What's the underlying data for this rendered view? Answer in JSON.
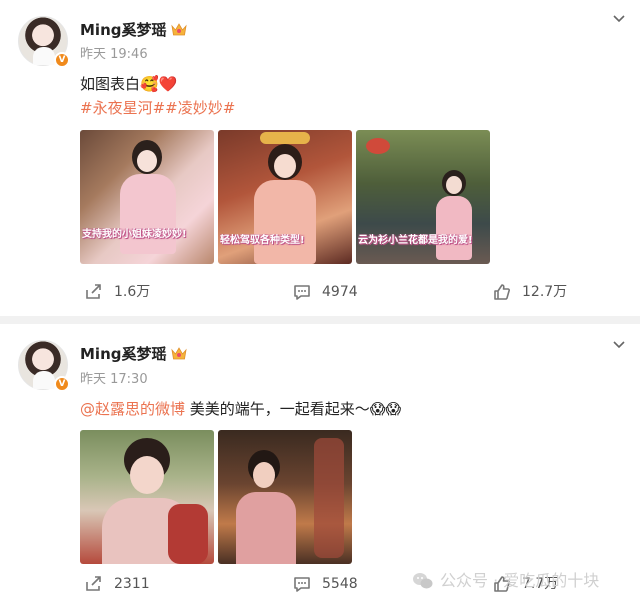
{
  "posts": [
    {
      "username": "Ming奚梦瑶",
      "verified_badge": "V",
      "time": "昨天 19:46",
      "text": "如图表白🥰❤️",
      "hashtags": "#永夜星河##凌妙妙#",
      "images": [
        {
          "caption": "支持我的小姐妹凌妙妙!"
        },
        {
          "caption": "轻松驾驭各种类型!"
        },
        {
          "caption": "云为衫小兰花都是我的爱!"
        }
      ],
      "repost_count": "1.6万",
      "comment_count": "4974",
      "like_count": "12.7万"
    },
    {
      "username": "Ming奚梦瑶",
      "verified_badge": "V",
      "time": "昨天 17:30",
      "mention": "@赵露思的微博",
      "text": " 美美的端午，一起看起来～😱😱",
      "repost_count": "2311",
      "comment_count": "5548",
      "like_count": "7.7万"
    }
  ],
  "watermark": {
    "label": "公众号 · 爱吃瓜的十块"
  },
  "colors": {
    "accent": "#eb7350",
    "badge": "#f08a1c",
    "muted": "#999999"
  },
  "icons": [
    "chevron-down-icon",
    "crown-icon",
    "repost-icon",
    "comment-icon",
    "like-icon",
    "wechat-icon"
  ]
}
